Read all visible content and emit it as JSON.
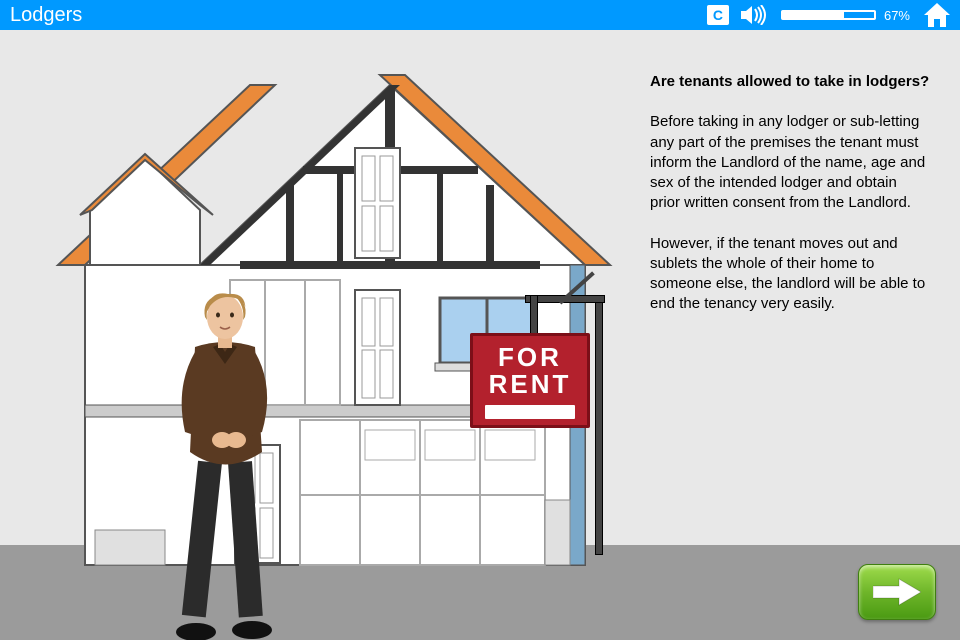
{
  "topbar": {
    "title": "Lodgers",
    "cc_label": "C",
    "volume_percent": 67,
    "volume_display": "67%"
  },
  "text": {
    "question": "Are tenants allowed to take in lodgers?",
    "p1": "Before taking in any lodger or sub-letting any part of the premises the tenant must inform the Landlord of the name, age and sex of the intended lodger and obtain prior written consent from the Landlord.",
    "p2": "However, if the tenant moves out and sublets the whole of their home to someone else, the landlord will be able to end the tenancy very easily."
  },
  "sign": {
    "line1": "FOR",
    "line2": "RENT"
  },
  "colors": {
    "brand": "#0099ff",
    "sign_red": "#b3212d",
    "next_green": "#6fb62a",
    "roof_orange": "#ea8a3a"
  }
}
